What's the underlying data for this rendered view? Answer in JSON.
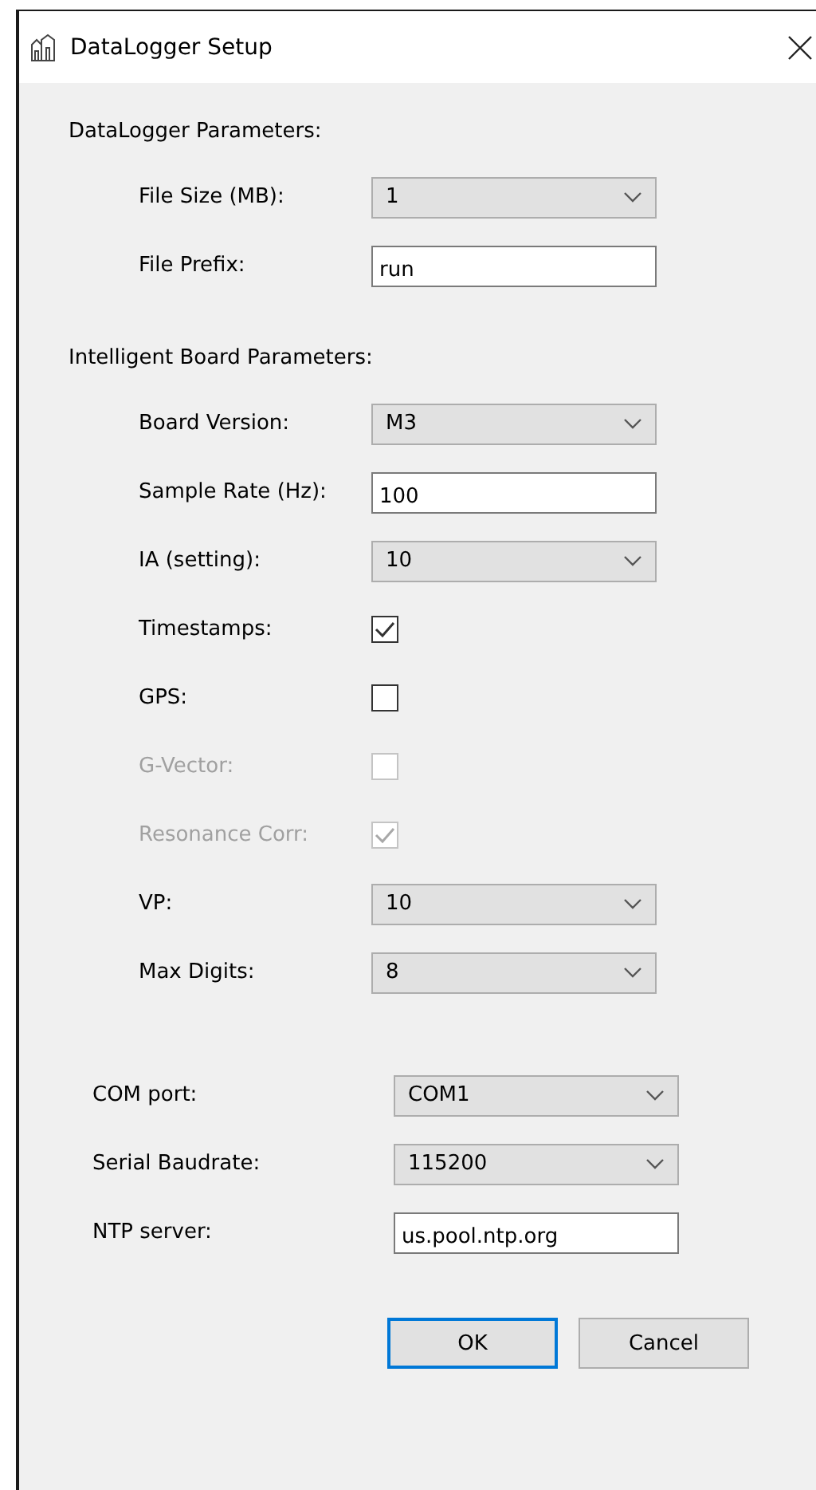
{
  "window": {
    "title": "DataLogger Setup"
  },
  "sections": [
    {
      "title": "DataLogger Parameters:",
      "rows": [
        {
          "kind": "combo",
          "label": "File Size (MB):",
          "value": "1"
        },
        {
          "kind": "text",
          "label": "File Prefix:",
          "value": "run"
        }
      ]
    },
    {
      "title": "Intelligent Board Parameters:",
      "rows": [
        {
          "kind": "combo",
          "label": "Board Version:",
          "value": "M3"
        },
        {
          "kind": "text",
          "label": "Sample Rate (Hz):",
          "value": "100"
        },
        {
          "kind": "combo",
          "label": "IA (setting):",
          "value": "10"
        },
        {
          "kind": "checkbox",
          "label": "Timestamps:",
          "checked": true,
          "disabled": false
        },
        {
          "kind": "checkbox",
          "label": "GPS:",
          "checked": false,
          "disabled": false
        },
        {
          "kind": "checkbox",
          "label": "G-Vector:",
          "checked": false,
          "disabled": true
        },
        {
          "kind": "checkbox",
          "label": "Resonance Corr:",
          "checked": true,
          "disabled": true
        },
        {
          "kind": "combo",
          "label": "VP:",
          "value": "10"
        },
        {
          "kind": "combo",
          "label": "Max Digits:",
          "value": "8"
        }
      ]
    }
  ],
  "connection": [
    {
      "kind": "combo",
      "label": "COM port:",
      "value": "COM1"
    },
    {
      "kind": "combo",
      "label": "Serial Baudrate:",
      "value": "115200"
    },
    {
      "kind": "text",
      "label": "NTP server:",
      "value": "us.pool.ntp.org"
    }
  ],
  "buttons": [
    {
      "label": "OK",
      "default": true
    },
    {
      "label": "Cancel",
      "default": false
    }
  ]
}
